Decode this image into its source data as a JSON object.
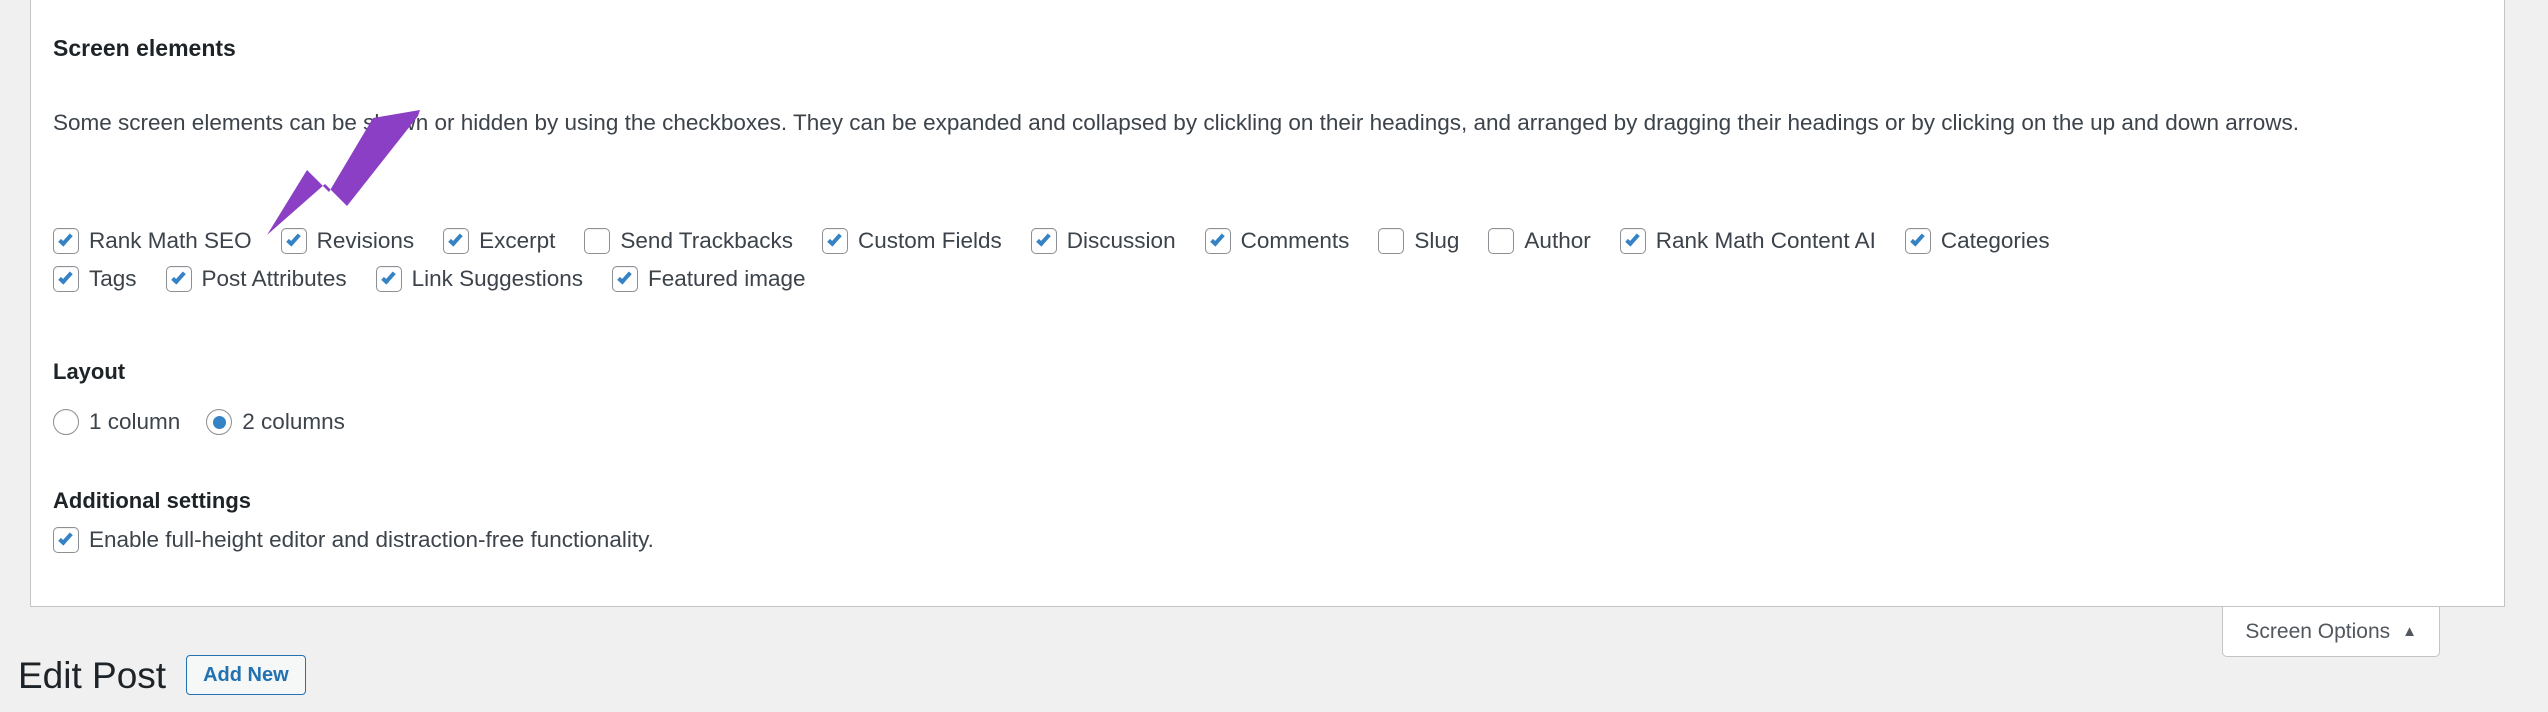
{
  "panel": {
    "heading": "Screen elements",
    "description": "Some screen elements can be shown or hidden by using the checkboxes. They can be expanded and collapsed by clickling on their headings, and arranged by dragging their headings or by clicking on the up and down arrows."
  },
  "screen_elements": {
    "row1": [
      {
        "label": "Rank Math SEO",
        "checked": true
      },
      {
        "label": "Revisions",
        "checked": true
      },
      {
        "label": "Excerpt",
        "checked": true
      },
      {
        "label": "Send Trackbacks",
        "checked": false
      },
      {
        "label": "Custom Fields",
        "checked": true
      },
      {
        "label": "Discussion",
        "checked": true
      },
      {
        "label": "Comments",
        "checked": true
      },
      {
        "label": "Slug",
        "checked": false
      },
      {
        "label": "Author",
        "checked": false
      },
      {
        "label": "Rank Math Content AI",
        "checked": true
      },
      {
        "label": "Categories",
        "checked": true
      }
    ],
    "row2": [
      {
        "label": "Tags",
        "checked": true
      },
      {
        "label": "Post Attributes",
        "checked": true
      },
      {
        "label": "Link Suggestions",
        "checked": true
      },
      {
        "label": "Featured image",
        "checked": true
      }
    ]
  },
  "layout": {
    "heading": "Layout",
    "options": [
      {
        "label": "1 column",
        "selected": false
      },
      {
        "label": "2 columns",
        "selected": true
      }
    ]
  },
  "additional_settings": {
    "heading": "Additional settings",
    "options": [
      {
        "label": "Enable full-height editor and distraction-free functionality.",
        "checked": true
      }
    ]
  },
  "screen_options_tab": {
    "label": "Screen Options",
    "arrow": "▲"
  },
  "page_header": {
    "title": "Edit Post",
    "add_new_label": "Add New"
  },
  "colors": {
    "accent_blue": "#3582c4",
    "link_blue": "#2271b1",
    "page_background": "#f0f0f1",
    "panel_background": "#ffffff",
    "panel_border": "#c3c4c7",
    "text": "#3c434a",
    "heading_text": "#1d2327",
    "cursor_purple": "#8b3fc4"
  }
}
